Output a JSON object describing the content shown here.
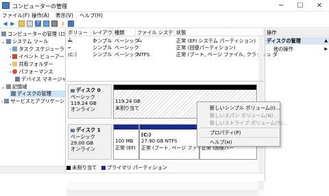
{
  "window": {
    "title": "コンピューターの管理",
    "minimize": "─",
    "maximize": "☐",
    "close": "✕"
  },
  "menu": [
    "ファイル(F)",
    "操作(A)",
    "表示(V)",
    "ヘルプ(H)"
  ],
  "toolbar": [
    "back-arrow",
    "forward-arrow",
    "up-folder",
    "properties",
    "help",
    "grid",
    "list",
    "key",
    "wrench"
  ],
  "tree": {
    "root": "コンピューターの管理 (ロ",
    "system_tools": "システム ツール",
    "task_scheduler": "タスク スケジューラ",
    "event_viewer": "イベント ビューアー",
    "shared_folders": "共有フォルダー",
    "performance": "パフォーマンス",
    "device_manager": "デバイス マネージャー",
    "storage": "記憶域",
    "disk_management": "ディスクの管理",
    "services_apps": "サービスとアプリケーション"
  },
  "volume_columns": [
    "ボリューム",
    "レイアウト",
    "種類",
    "ファイル システム",
    "状態"
  ],
  "volumes": [
    {
      "volume": "━",
      "layout": "シンプル",
      "type": "ベーシック",
      "fs": "",
      "status": "正常 (EFI システム パーティション)"
    },
    {
      "volume": "━",
      "layout": "シンプル",
      "type": "ベーシック",
      "fs": "",
      "status": "正常 (回復パーティション)"
    },
    {
      "volume": "(C:)",
      "layout": "シンプル",
      "type": "ベーシック",
      "fs": "NTFS",
      "status": "正常 (ブート, ページ ファイル, クラッシュ ダ"
    }
  ],
  "disks": [
    {
      "name": "ディスク 0",
      "kind": "ベーシック",
      "size": "119.24 GB",
      "state": "オンライン",
      "partitions": [
        {
          "size": "119.24 GB",
          "label": "未割り当て"
        }
      ]
    },
    {
      "name": "ディスク 1",
      "kind": "ベーシック",
      "size": "29.00 GB",
      "state": "オンライン",
      "partitions": [
        {
          "title": "",
          "size": "100 MB",
          "label": "正常 (EFI"
        },
        {
          "title": "(C:)",
          "size": "27.90 GB NTFS",
          "label": "正常 (ブート, ページ ファイル"
        },
        {
          "title": "",
          "size": "",
          "label": "正常 (回復パー"
        }
      ]
    }
  ],
  "legend": {
    "unallocated": "未割り当て",
    "primary": "プライマリ パーティション"
  },
  "actions": {
    "header": "操作",
    "section": "ディスクの管理",
    "more": "他の操作"
  },
  "context_menu": {
    "new_simple": "新しいシンプル ボリューム(I)...",
    "new_spanned": "新しいスパン ボリューム(N)...",
    "new_striped": "新しいストライプ ボリューム(T)...",
    "properties": "プロパティ(P)",
    "help": "ヘルプ(H)"
  },
  "colors": {
    "unallocated_bar": "#000000",
    "primary_bar": "#1a2a8a",
    "actions_section": "#d8e6f4"
  }
}
